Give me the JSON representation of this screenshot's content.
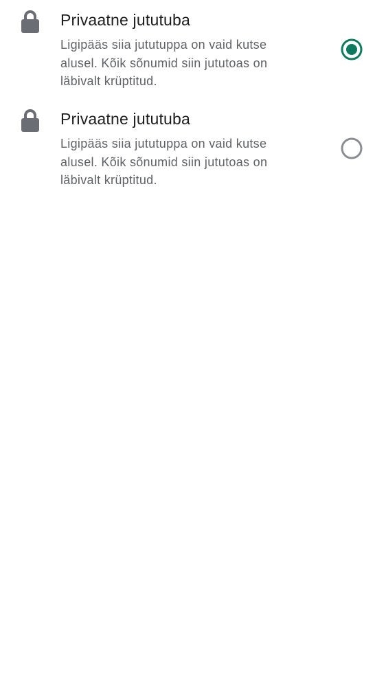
{
  "options": [
    {
      "title": "Privaatne jututuba",
      "description": "Ligipääs siia jututuppa on vaid kutse alusel. Kõik sõnumid siin jututoas on läbivalt krüptitud.",
      "selected": true,
      "icon": "lock-icon"
    },
    {
      "title": "Privaatne jututuba",
      "description": "Ligipääs siia jututuppa on vaid kutse alusel. Kõik sõnumid siin jututoas on läbivalt krüptitud.",
      "selected": false,
      "icon": "lock-icon"
    }
  ],
  "colors": {
    "accent": "#0d7a5f",
    "radio_off": "#8a8d92",
    "icon": "#6a6d73",
    "title": "#1c1c1e",
    "description": "#5e6166"
  }
}
